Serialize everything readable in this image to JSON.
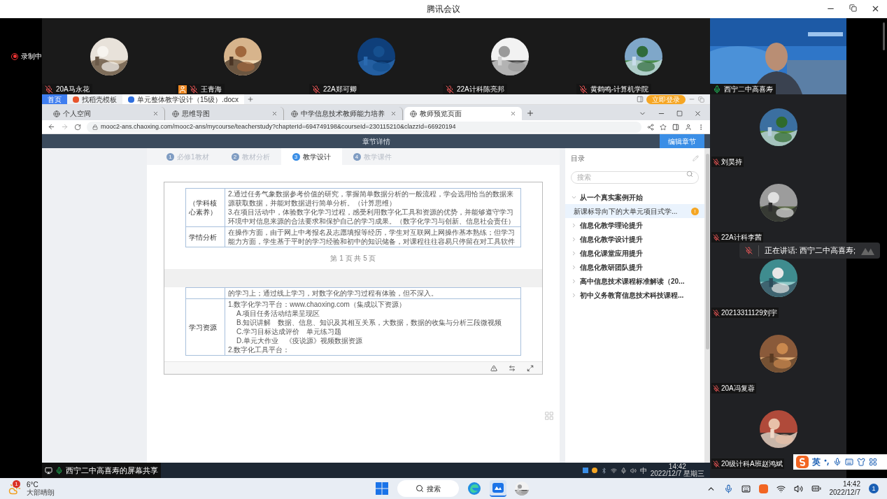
{
  "app_title": "腾讯会议",
  "recording": {
    "label": "录制中"
  },
  "top_participants": [
    {
      "name": "20A马永花",
      "muted": true,
      "host": false
    },
    {
      "name": "王青海",
      "muted": true,
      "host": true
    },
    {
      "name": "22A郑可卿",
      "muted": true,
      "host": false
    },
    {
      "name": "22A计科陈亮邦",
      "muted": true,
      "host": false
    },
    {
      "name": "黄鹤鸣-计算机学院",
      "muted": true,
      "host": false
    }
  ],
  "speaker": {
    "name": "西宁二中高喜寿",
    "muted": false
  },
  "side_participants": [
    {
      "name": "刘昊持",
      "muted": true
    },
    {
      "name": "22A计科李茜",
      "muted": true
    },
    {
      "name": "20213311129刘宇",
      "muted": true
    },
    {
      "name": "20A冯复蓉",
      "muted": true
    },
    {
      "name": "20级计科A班赵鸿斌",
      "muted": true
    }
  ],
  "speaking_toast": {
    "text": "正在讲话: 西宁二中高喜寿;",
    "muted": true
  },
  "share_label": "西宁二中高喜寿的屏幕共享",
  "shared_screen": {
    "wps_tabs": [
      {
        "kind": "home",
        "label": "首页",
        "selected": false
      },
      {
        "kind": "template",
        "label": "找稻壳模板",
        "selected": false
      },
      {
        "kind": "doc",
        "label": "单元整体教学设计（15级）.docx",
        "selected": true
      }
    ],
    "wps_login": "立即登录",
    "browser_tabs": [
      {
        "label": "个人空间",
        "selected": false
      },
      {
        "label": "思维导图",
        "selected": false
      },
      {
        "label": "中学信息技术教师能力培养",
        "selected": false
      },
      {
        "label": "教师预览页面",
        "selected": true
      }
    ],
    "url": "mooc2-ans.chaoxing.com/mooc2-ans/mycourse/teacherstudy?chapterId=694749198&courseId=230115210&clazzId=66920194",
    "header": {
      "title": "章节详情",
      "edit_button": "编辑章节"
    },
    "step_tabs": [
      {
        "number": "1",
        "label": "必修1教材",
        "selected": false
      },
      {
        "number": "2",
        "label": "教材分析",
        "selected": false
      },
      {
        "number": "3",
        "label": "教学设计",
        "selected": true
      },
      {
        "number": "4",
        "label": "教学课件",
        "selected": false
      }
    ],
    "document": {
      "pages": [
        {
          "rows": [
            {
              "heading": "（学科核心素养）",
              "paragraphs": [
                {
                  "text": "2.通过任务气象数据参考价值的研究，掌握简单数据分析的一般流程，学会选用恰当的数据来源获取数据，并能对数据进行简单分析。（计算思维）"
                },
                {
                  "text": "3.在项目活动中，体验数字化学习过程，感受利用数字化工具和资源的优势，并能够遵守学习环境中对信息来源的合法要求和保护自己的学习成果。（数字化学习与创新、信息社会责任）"
                }
              ]
            },
            {
              "heading": "学情分析",
              "paragraphs": [
                {
                  "text": "在操作方面，由于网上中考报名及志愿填报等经历，学生对互联网上网操作基本熟练；但学习能力方面，学生基于平时的学习经验和初中的知识储备，对课程往往容易只停留在对工具软件"
                }
              ]
            }
          ],
          "footer": "第 1 页 共 5 页"
        },
        {
          "rows": [
            {
              "paragraphs": [
                {
                  "text": "的学习上；通过线上学习，对数字化的学习过程有体验，但不深入。"
                }
              ]
            },
            {
              "heading": "学习资源",
              "paragraphs": [
                {
                  "text": "1.数字化学习平台：www.chaoxing.com（集成以下资源）",
                  "children": [
                    {
                      "text": "A.项目任务活动结果呈现区"
                    },
                    {
                      "text": "B.知识讲解　数据、信息、知识及其相互关系，大数据，数据的收集与分析三段微视频"
                    },
                    {
                      "text": "C.学习目标达成评价　单元练习题"
                    },
                    {
                      "text": "D.单元大作业　《疫说源》视频数据资源"
                    }
                  ]
                },
                {
                  "text": "2.数字化工具平台："
                }
              ]
            }
          ]
        }
      ]
    },
    "toc": {
      "title": "目录",
      "search_placeholder": "搜索",
      "items": [
        {
          "label": "从一个真实案例开始",
          "expanded": true,
          "children": [
            {
              "label": "新课标导向下的大单元项目式学...",
              "selected": true,
              "badge": "!"
            }
          ]
        },
        {
          "label": "信息化教学理论提升",
          "expanded": false
        },
        {
          "label": "信息化教学设计提升",
          "expanded": false
        },
        {
          "label": "信息化课堂应用提升",
          "expanded": false
        },
        {
          "label": "信息化教研团队提升",
          "expanded": false
        },
        {
          "label": "高中信息技术课程标准解读（20...",
          "expanded": false
        },
        {
          "label": "初中义务教育信息技术科技课程...",
          "expanded": false
        }
      ]
    },
    "remote_tray": {
      "ime": "中",
      "time": "14:42",
      "date": "2022/12/7 星期三"
    }
  },
  "ime_bar": {
    "mode": "英"
  },
  "taskbar": {
    "weather": {
      "temp": "6°C",
      "desc": "大部晴朗",
      "badge": "1"
    },
    "search": "搜索",
    "time": "14:42",
    "date": "2022/12/7",
    "notifications": "1"
  }
}
